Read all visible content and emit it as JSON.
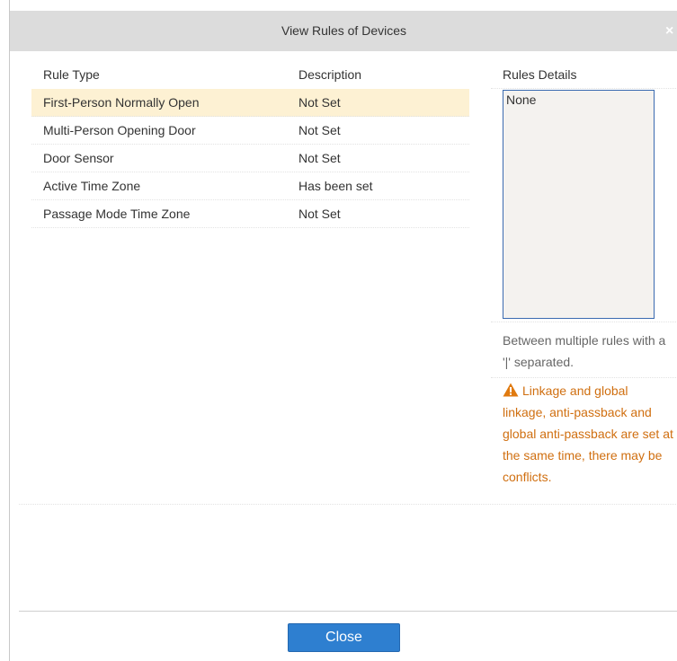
{
  "dialog": {
    "title": "View Rules of Devices",
    "close_glyph": "×"
  },
  "table": {
    "headers": {
      "rule_type": "Rule Type",
      "description": "Description"
    },
    "rows": [
      {
        "rule_type": "First-Person Normally Open",
        "description": "Not Set",
        "selected": true
      },
      {
        "rule_type": "Multi-Person Opening Door",
        "description": "Not Set",
        "selected": false
      },
      {
        "rule_type": "Door Sensor",
        "description": "Not Set",
        "selected": false
      },
      {
        "rule_type": "Active Time Zone",
        "description": "Has been set",
        "selected": false
      },
      {
        "rule_type": "Passage Mode Time Zone",
        "description": "Not Set",
        "selected": false
      }
    ]
  },
  "details": {
    "label": "Rules Details",
    "value": "None",
    "hint": "Between multiple rules with a '|' separated.",
    "warning_icon": "warning-triangle-icon",
    "warning": "Linkage and global linkage, anti-passback and global anti-passback are set at the same time, there may be conflicts."
  },
  "footer": {
    "close_label": "Close"
  },
  "colors": {
    "title_bar": "#dcdcdc",
    "selected_row": "#fdf1d3",
    "warning_text": "#d06f10",
    "button": "#2e7fd0"
  }
}
